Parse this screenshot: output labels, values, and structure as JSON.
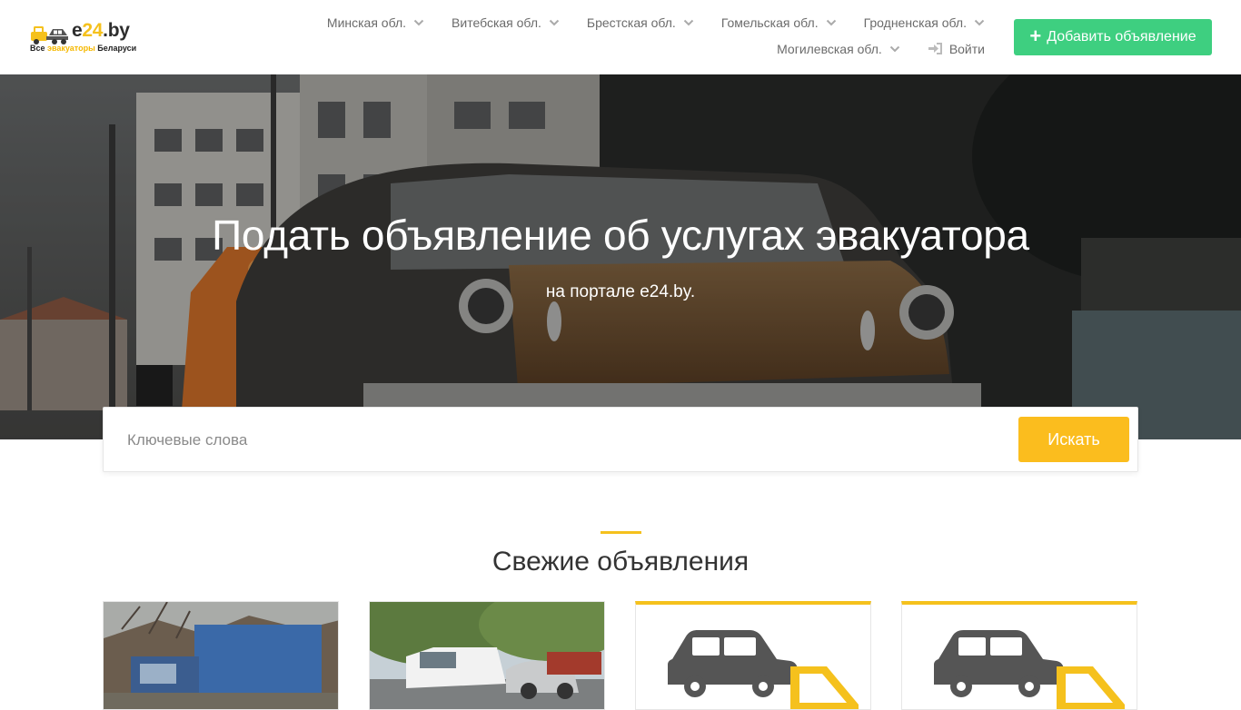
{
  "logo": {
    "name_prefix": "e",
    "name_highlight": "24",
    "name_suffix": ".by",
    "tagline_prefix": "Все ",
    "tagline_highlight": "эвакуаторы",
    "tagline_suffix": " Беларуси"
  },
  "nav": {
    "items": [
      {
        "label": "Минская обл."
      },
      {
        "label": "Витебская обл."
      },
      {
        "label": "Брестская обл."
      },
      {
        "label": "Гомельская обл."
      },
      {
        "label": "Гродненская обл."
      },
      {
        "label": "Могилевская обл."
      }
    ],
    "login_label": "Войти"
  },
  "add_button": {
    "label": "Добавить объявление"
  },
  "hero": {
    "title": "Подать объявление об услугах эвакуатора",
    "subtitle": "на портале e24.by."
  },
  "search": {
    "placeholder": "Ключевые слова",
    "button_label": "Искать"
  },
  "fresh": {
    "title": "Свежие объявления"
  },
  "colors": {
    "accent_yellow": "#f5c11d",
    "button_green": "#3ecf80",
    "search_button": "#fbbd1e"
  }
}
